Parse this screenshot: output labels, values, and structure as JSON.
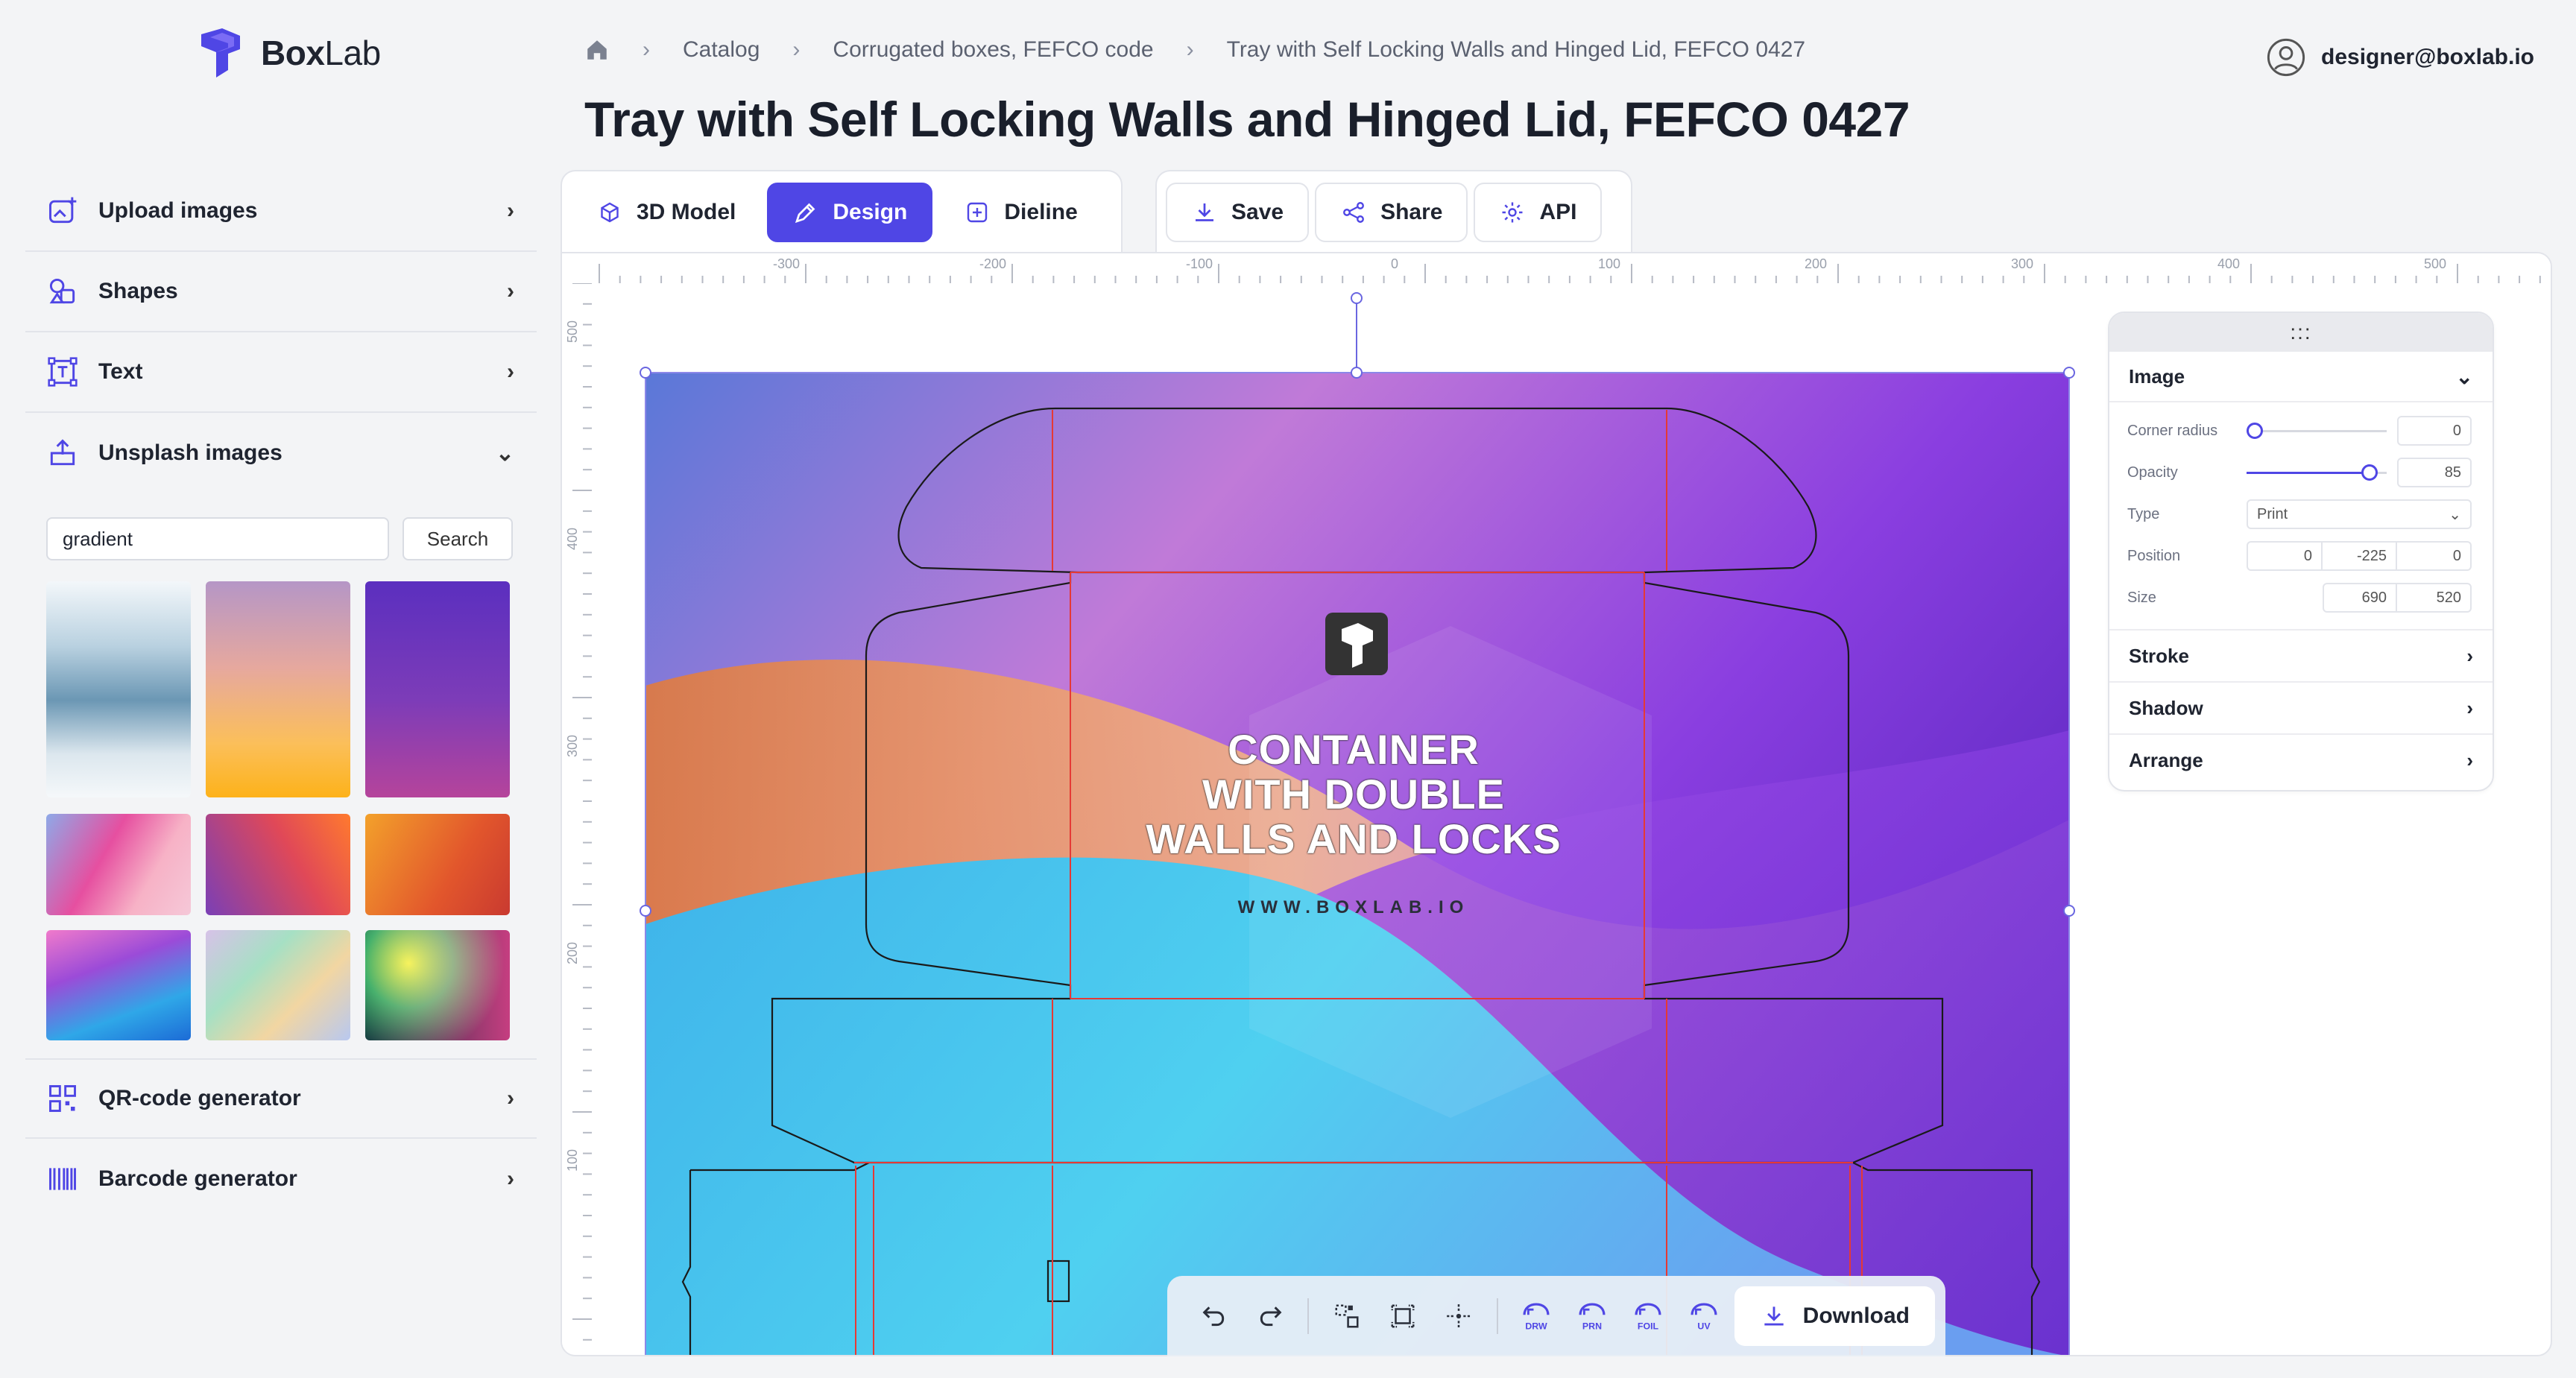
{
  "brand": {
    "name_bold": "Box",
    "name_light": "Lab"
  },
  "breadcrumb": {
    "items": [
      "Catalog",
      "Corrugated boxes, FEFCO code",
      "Tray with Self Locking Walls and Hinged Lid, FEFCO 0427"
    ]
  },
  "user": {
    "email": "designer@boxlab.io"
  },
  "page_title": "Tray with Self Locking Walls and Hinged Lid, FEFCO 0427",
  "sidebar": {
    "items": [
      {
        "label": "Upload images",
        "icon": "upload-image-icon"
      },
      {
        "label": "Shapes",
        "icon": "shapes-icon"
      },
      {
        "label": "Text",
        "icon": "text-icon"
      },
      {
        "label": "Unsplash images",
        "icon": "unsplash-icon"
      },
      {
        "label": "QR-code generator",
        "icon": "qr-code-icon"
      },
      {
        "label": "Barcode generator",
        "icon": "barcode-icon"
      }
    ],
    "search": {
      "value": "gradient",
      "button": "Search"
    }
  },
  "tabs": {
    "model": "3D Model",
    "design": "Design",
    "dieline": "Dieline"
  },
  "actions": {
    "save": "Save",
    "share": "Share",
    "api": "API"
  },
  "ruler": {
    "h_labels": [
      "-300",
      "-200",
      "-100",
      "0",
      "100",
      "200",
      "300",
      "400",
      "500"
    ],
    "v_labels": [
      "500",
      "400",
      "300",
      "200",
      "100"
    ]
  },
  "artwork": {
    "headline": [
      "CONTAINER",
      "WITH DOUBLE",
      "WALLS AND LOCKS"
    ],
    "url": "WWW.BOXLAB.IO"
  },
  "properties": {
    "handle": ":::",
    "section": "Image",
    "corner_radius": {
      "label": "Corner radius",
      "value": "0"
    },
    "opacity": {
      "label": "Opacity",
      "value": "85"
    },
    "type": {
      "label": "Type",
      "value": "Print"
    },
    "position": {
      "label": "Position",
      "x": "0",
      "y": "-225",
      "z": "0"
    },
    "size": {
      "label": "Size",
      "w": "690",
      "h": "520"
    },
    "sections": [
      "Stroke",
      "Shadow",
      "Arrange"
    ]
  },
  "toolbar": {
    "download": "Download",
    "labels": {
      "drw": "DRW",
      "prn": "PRN",
      "foil": "FOIL",
      "uv": "UV"
    }
  },
  "colors": {
    "accent": "#4f46e5",
    "dieline": "#e53935"
  }
}
